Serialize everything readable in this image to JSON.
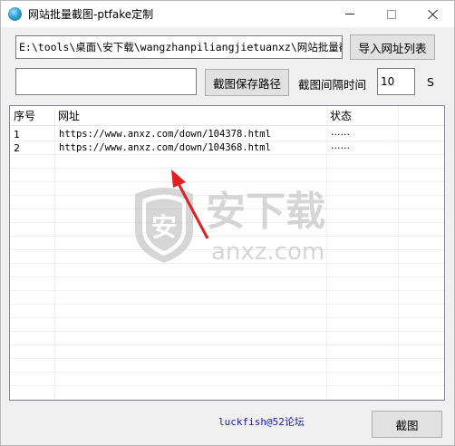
{
  "window": {
    "title": "网站批量截图-ptfake定制",
    "icon": "globe-app-icon"
  },
  "toolbar": {
    "url_list_path": "E:\\tools\\桌面\\安下载\\wangzhanpiliangjietuanxz\\网站批量截图\\",
    "import_button": "导入网址列表",
    "save_path_value": "",
    "save_path_button": "截图保存路径",
    "interval_label": "截图间隔时间",
    "interval_value": "10",
    "interval_unit": "S"
  },
  "grid": {
    "columns": [
      "序号",
      "网址",
      "状态"
    ],
    "rows": [
      {
        "index": "1",
        "url": "https://www.anxz.com/down/104378.html",
        "status": "······"
      },
      {
        "index": "2",
        "url": "https://www.anxz.com/down/104368.html",
        "status": "······"
      }
    ]
  },
  "watermark": {
    "brand": "安下载",
    "domain": "anxz.com",
    "shield_char": "安"
  },
  "footer": {
    "credit": "luckfish@52论坛",
    "capture_button": "截图"
  },
  "colors": {
    "arrow": "#e02020",
    "link": "#1a1aa0"
  }
}
